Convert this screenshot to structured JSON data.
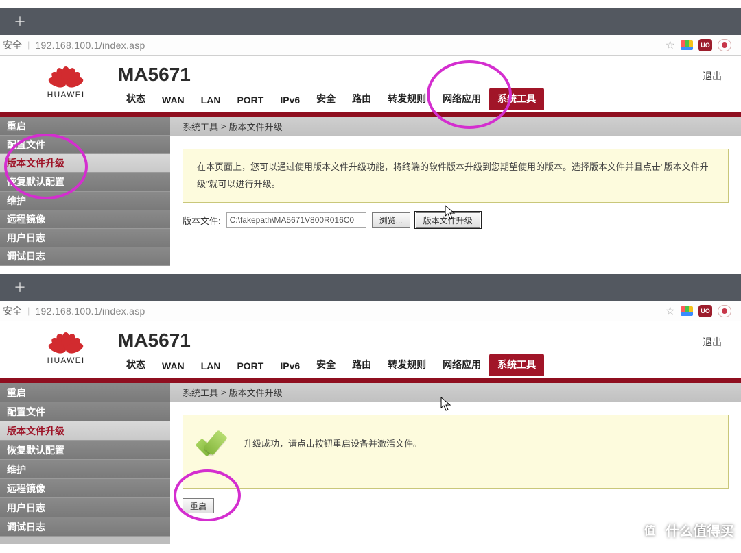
{
  "browser": {
    "security_label": "安全",
    "url": "192.168.100.1/index.asp"
  },
  "router": {
    "brand": "HUAWEI",
    "model": "MA5671",
    "logout": "退出",
    "topnav": [
      "状态",
      "WAN",
      "LAN",
      "PORT",
      "IPv6",
      "安全",
      "路由",
      "转发规则",
      "网络应用",
      "系统工具"
    ],
    "topnav_active": "系统工具",
    "active_tool": "系统工具",
    "sidemenu": [
      "重启",
      "配置文件",
      "版本文件升级",
      "恢复默认配置",
      "维护",
      "远程镜像",
      "用户日志",
      "调试日志"
    ],
    "sidemenu_active": "版本文件升级",
    "breadcrumb_a": "系统工具",
    "breadcrumb_sep": ">",
    "breadcrumb_b": "版本文件升级"
  },
  "upgrade": {
    "info": "在本页面上，您可以通过使用版本文件升级功能，将终端的软件版本升级到您期望使用的版本。选择版本文件并且点击\"版本文件升级\"就可以进行升级。",
    "file_label": "版本文件:",
    "file_value": "C:\\fakepath\\MA5671V800R016C0",
    "browse": "浏览...",
    "upgrade_btn": "版本文件升级"
  },
  "success": {
    "msg": "升级成功，请点击按钮重启设备并激活文件。",
    "reboot_btn": "重启"
  },
  "watermark": "什么值得买"
}
